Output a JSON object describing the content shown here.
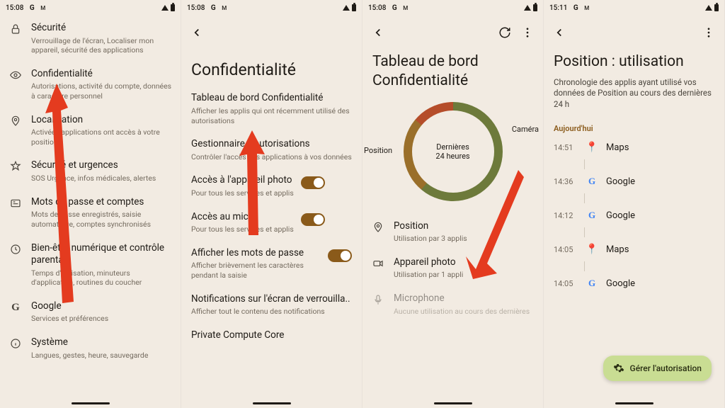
{
  "screens": [
    {
      "status": {
        "time": "15:08",
        "icons": [
          "G",
          "M"
        ]
      },
      "items": [
        {
          "icon": "lock",
          "title": "Sécurité",
          "sub": "Verrouillage de l'écran, Localiser mon appareil, sécurité des applications"
        },
        {
          "icon": "eye",
          "title": "Confidentialité",
          "sub": "Autorisations, activité du compte, données à caractère personnel"
        },
        {
          "icon": "pin",
          "title": "Localisation",
          "sub": "Activée : applications ont accès à votre position"
        },
        {
          "icon": "star",
          "title": "Sécurité et urgences",
          "sub": "SOS Urgence, infos médicales, alertes"
        },
        {
          "icon": "key",
          "title": "Mots de passe et comptes",
          "sub": "Mots de passe enregistrés, saisie automatique, comptes synchronisés"
        },
        {
          "icon": "heart",
          "title": "Bien-être numérique et contrôle parental",
          "sub": "Temps d'utilisation, minuteurs d'application, routines du coucher"
        },
        {
          "icon": "google",
          "title": "Google",
          "sub": "Services et préférences"
        },
        {
          "icon": "info",
          "title": "Système",
          "sub": "Langues, gestes, heure, sauvegarde"
        }
      ]
    },
    {
      "status": {
        "time": "15:08",
        "icons": [
          "G",
          "M"
        ]
      },
      "title": "Confidentialité",
      "rows": [
        {
          "title": "Tableau de bord Confidentialité",
          "sub": "Afficher les applis qui ont récemment utilisé des autorisations"
        },
        {
          "title": "Gestionnaire d'autorisations",
          "sub": "Contrôler l'accès des applications à vos données"
        },
        {
          "title": "Accès à l'appareil photo",
          "sub": "Pour tous les services et applis",
          "toggle": true
        },
        {
          "title": "Accès au micro",
          "sub": "Pour tous les services et applis",
          "toggle": true
        },
        {
          "title": "Afficher les mots de passe",
          "sub": "Afficher brièvement les caractères pendant la saisie",
          "toggle": true
        },
        {
          "title": "Notifications sur l'écran de verrouilla..",
          "sub": "Afficher tout le contenu des notifications"
        },
        {
          "title": "Private Compute Core",
          "sub": ""
        }
      ]
    },
    {
      "status": {
        "time": "15:08",
        "icons": [
          "G",
          "M"
        ]
      },
      "title": "Tableau de bord Confidentialité",
      "donut": {
        "center1": "Dernières",
        "center2": "24 heures",
        "labels": [
          "Position",
          "Caméra"
        ]
      },
      "items": [
        {
          "icon": "pin",
          "title": "Position",
          "sub": "Utilisation par 3 applis"
        },
        {
          "icon": "camera",
          "title": "Appareil photo",
          "sub": "Utilisation par 1 appli"
        },
        {
          "icon": "mic",
          "title": "Microphone",
          "sub": "Aucune utilisation au cours des dernières",
          "faded": true
        }
      ]
    },
    {
      "status": {
        "time": "15:11",
        "icons": [
          "G",
          "M"
        ]
      },
      "title": "Position : utilisation",
      "subtitle": "Chronologie des applis ayant utilisé vos données de Position au cours des dernières 24 h",
      "section": "Aujourd'hui",
      "rows": [
        {
          "time": "14:51",
          "app": "Maps",
          "icon": "maps"
        },
        {
          "time": "14:36",
          "app": "Google",
          "icon": "google"
        },
        {
          "time": "14:12",
          "app": "Google",
          "icon": "google"
        },
        {
          "time": "14:05",
          "app": "Maps",
          "icon": "maps"
        },
        {
          "time": "14:05",
          "app": "Google",
          "icon": "google"
        }
      ],
      "fab": "Gérer l'autorisation"
    }
  ]
}
